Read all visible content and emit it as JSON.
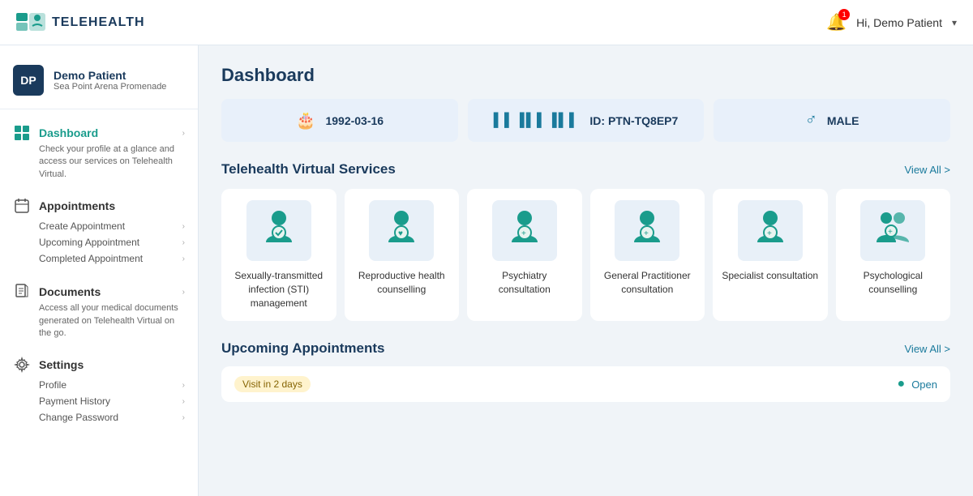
{
  "topnav": {
    "logo_text": "TELEHEALTH",
    "bell_count": "1",
    "user_greeting": "Hi, Demo Patient",
    "chevron": "▾"
  },
  "sidebar": {
    "user": {
      "initials": "DP",
      "name": "Demo Patient",
      "location": "Sea Point Arena Promenade"
    },
    "nav": [
      {
        "id": "dashboard",
        "label": "Dashboard",
        "active": true,
        "desc": "Check your profile at a glance and access our services on Telehealth Virtual.",
        "subitems": []
      },
      {
        "id": "appointments",
        "label": "Appointments",
        "active": false,
        "desc": "",
        "subitems": [
          "Create Appointment",
          "Upcoming Appointment",
          "Completed Appointment"
        ]
      },
      {
        "id": "documents",
        "label": "Documents",
        "active": false,
        "desc": "Access all your medical documents generated on Telehealth Virtual on the go.",
        "subitems": []
      },
      {
        "id": "settings",
        "label": "Settings",
        "active": false,
        "desc": "",
        "subitems": [
          "Profile",
          "Payment History",
          "Change Password"
        ]
      }
    ]
  },
  "main": {
    "page_title": "Dashboard",
    "info_cards": [
      {
        "id": "dob",
        "icon": "🎂",
        "text": "1992-03-16"
      },
      {
        "id": "patient_id",
        "icon": "▌▌▌▌▌",
        "text": "ID: PTN-TQ8EP7"
      },
      {
        "id": "gender",
        "icon": "♂",
        "text": "MALE"
      }
    ],
    "services_section": {
      "title": "Telehealth Virtual Services",
      "view_all": "View All >",
      "services": [
        {
          "id": "sti",
          "label": "Sexually-transmitted infection (STI) management"
        },
        {
          "id": "reproductive",
          "label": "Reproductive health counselling"
        },
        {
          "id": "psychiatry",
          "label": "Psychiatry consultation"
        },
        {
          "id": "gp",
          "label": "General Practitioner consultation"
        },
        {
          "id": "specialist",
          "label": "Specialist consultation"
        },
        {
          "id": "psychological",
          "label": "Psychological counselling"
        }
      ]
    },
    "appointments_section": {
      "title": "Upcoming Appointments",
      "view_all": "View All >",
      "badge": "Visit in 2 days",
      "status": "Open"
    }
  }
}
